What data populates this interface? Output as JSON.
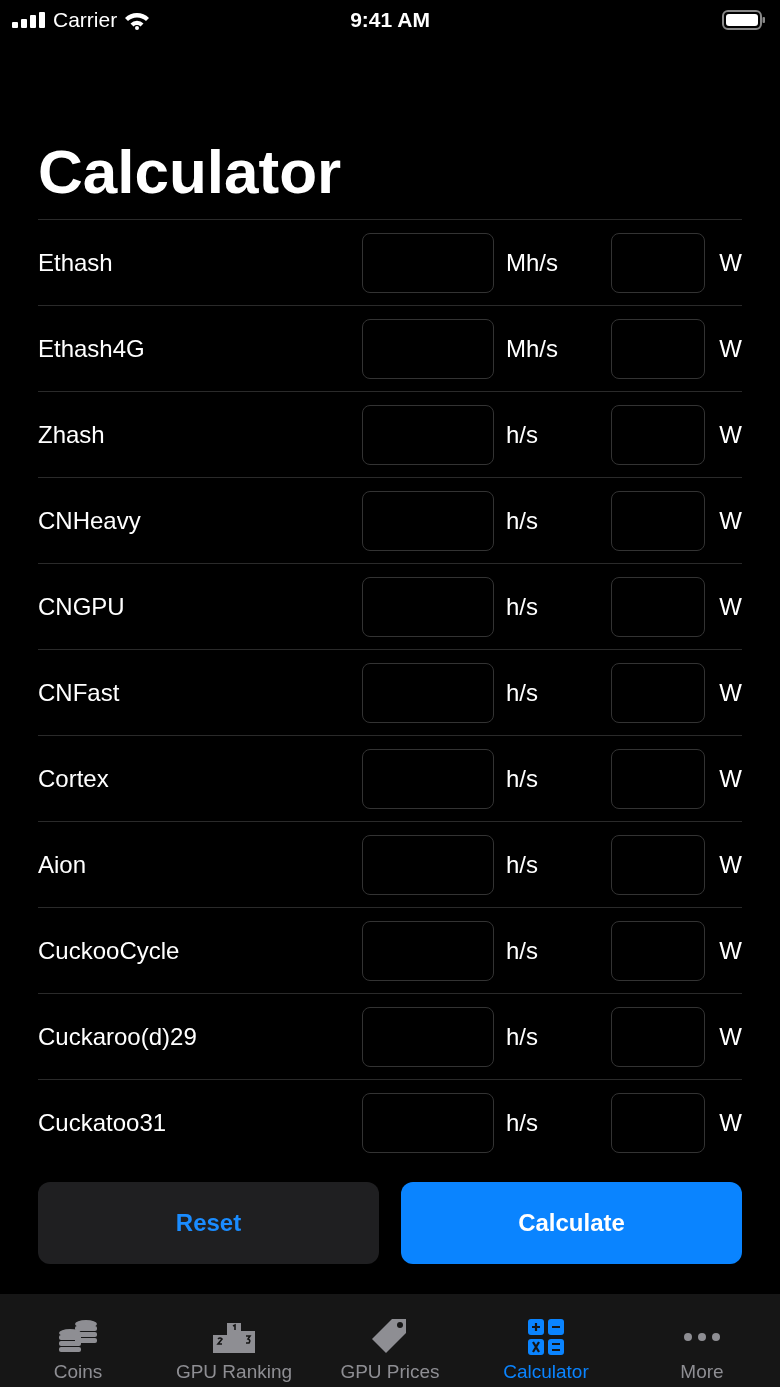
{
  "status_bar": {
    "carrier": "Carrier",
    "time": "9:41 AM"
  },
  "title": "Calculator",
  "rows": [
    {
      "name": "Ethash",
      "rate_unit": "Mh/s",
      "power_unit": "W"
    },
    {
      "name": "Ethash4G",
      "rate_unit": "Mh/s",
      "power_unit": "W"
    },
    {
      "name": "Zhash",
      "rate_unit": "h/s",
      "power_unit": "W"
    },
    {
      "name": "CNHeavy",
      "rate_unit": "h/s",
      "power_unit": "W"
    },
    {
      "name": "CNGPU",
      "rate_unit": "h/s",
      "power_unit": "W"
    },
    {
      "name": "CNFast",
      "rate_unit": "h/s",
      "power_unit": "W"
    },
    {
      "name": "Cortex",
      "rate_unit": "h/s",
      "power_unit": "W"
    },
    {
      "name": "Aion",
      "rate_unit": "h/s",
      "power_unit": "W"
    },
    {
      "name": "CuckooCycle",
      "rate_unit": "h/s",
      "power_unit": "W"
    },
    {
      "name": "Cuckaroo(d)29",
      "rate_unit": "h/s",
      "power_unit": "W"
    },
    {
      "name": "Cuckatoo31",
      "rate_unit": "h/s",
      "power_unit": "W"
    }
  ],
  "buttons": {
    "reset": "Reset",
    "calculate": "Calculate"
  },
  "tabs": [
    {
      "kind": "coins",
      "label": "Coins",
      "selected": false
    },
    {
      "kind": "ranking",
      "label": "GPU Ranking",
      "selected": false
    },
    {
      "kind": "tag",
      "label": "GPU Prices",
      "selected": false
    },
    {
      "kind": "calculator",
      "label": "Calculator",
      "selected": true
    },
    {
      "kind": "more",
      "label": "More",
      "selected": false
    }
  ]
}
